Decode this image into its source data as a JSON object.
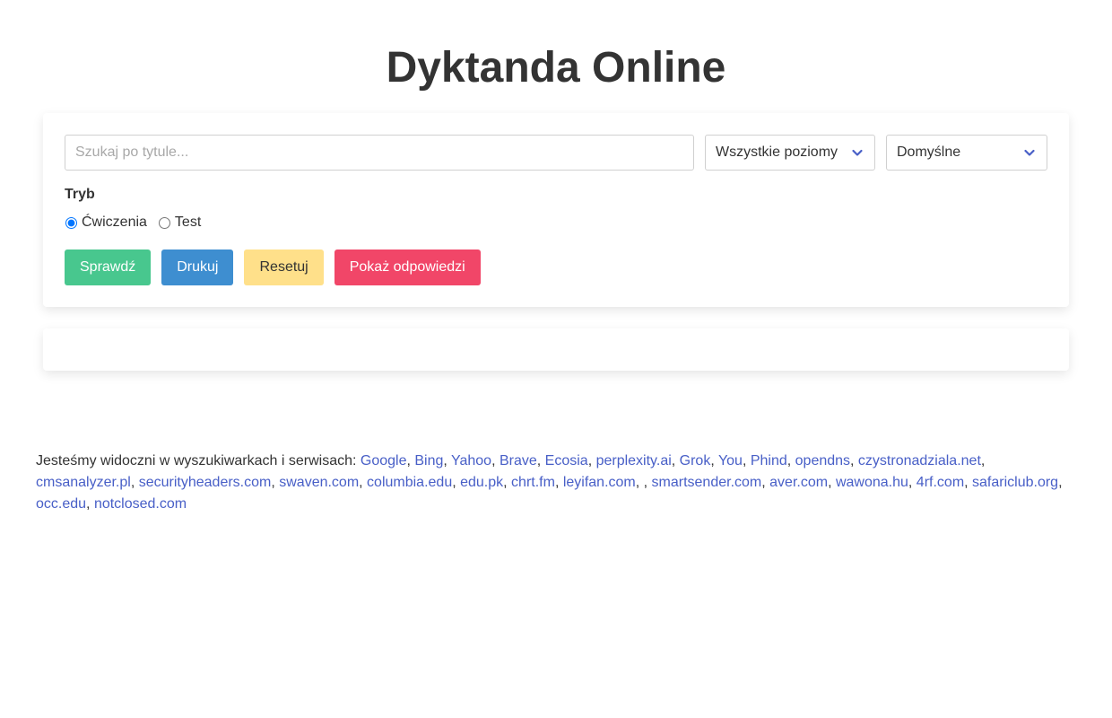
{
  "title": "Dyktanda Online",
  "search": {
    "placeholder": "Szukaj po tytule..."
  },
  "filters": {
    "level": "Wszystkie poziomy",
    "sort": "Domyślne"
  },
  "mode": {
    "label": "Tryb",
    "options": [
      {
        "label": "Ćwiczenia",
        "checked": true
      },
      {
        "label": "Test",
        "checked": false
      }
    ]
  },
  "buttons": {
    "check": "Sprawdź",
    "print": "Drukuj",
    "reset": "Resetuj",
    "show_answers": "Pokaż odpowiedzi"
  },
  "footer": {
    "intro": "Jesteśmy widoczni w wyszukiwarkach i serwisach: ",
    "links": [
      "Google",
      "Bing",
      "Yahoo",
      "Brave",
      "Ecosia",
      "perplexity.ai",
      "Grok",
      "You",
      "Phind",
      "opendns",
      "czystronadziala.net",
      "cmsanalyzer.pl",
      "securityheaders.com",
      "swaven.com",
      "columbia.edu",
      "edu.pk",
      "chrt.fm",
      "leyifan.com",
      "",
      "smartsender.com",
      "aver.com",
      "wawona.hu",
      "4rf.com",
      "safariclub.org",
      "occ.edu",
      "notclosed.com"
    ]
  },
  "colors": {
    "success": "#48c78e",
    "info": "#3e8ed0",
    "warning": "#ffe08a",
    "danger": "#f14668",
    "link": "#485fc7"
  }
}
